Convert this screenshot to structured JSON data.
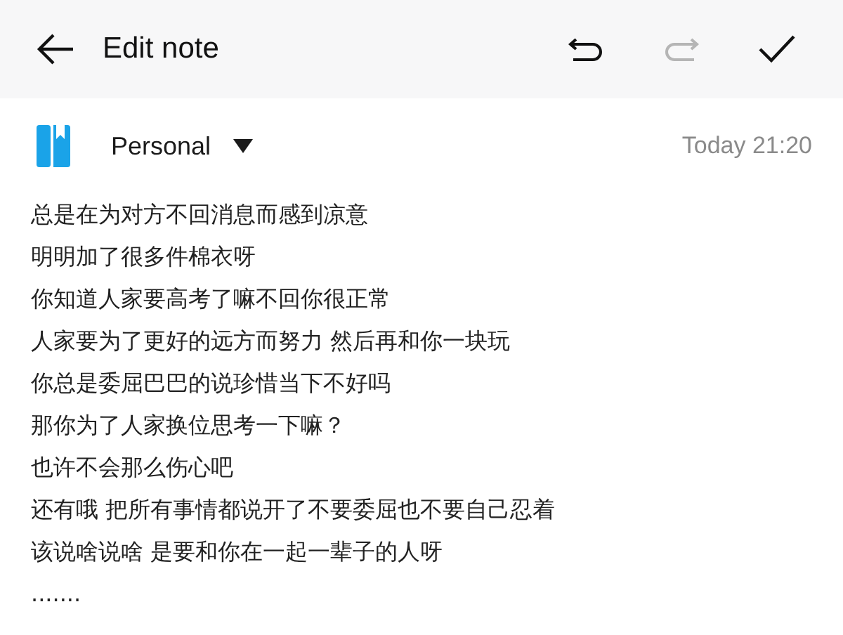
{
  "header": {
    "title": "Edit note",
    "actions": [
      {
        "kind": "undo",
        "disabled": false
      },
      {
        "kind": "redo",
        "disabled": true
      },
      {
        "kind": "done",
        "disabled": false
      }
    ]
  },
  "note": {
    "folder": "Personal",
    "time": "Today 21:20",
    "lines": [
      "总是在为对方不回消息而感到凉意",
      "明明加了很多件棉衣呀",
      "你知道人家要高考了嘛不回你很正常",
      "人家要为了更好的远方而努力 然后再和你一块玩",
      "你总是委屈巴巴的说珍惜当下不好吗",
      "那你为了人家换位思考一下嘛？",
      "也许不会那么伤心吧",
      "还有哦 把所有事情都说开了不要委屈也不要自己忍着",
      "该说啥说啥 是要和你在一起一辈子的人呀",
      "......."
    ]
  }
}
